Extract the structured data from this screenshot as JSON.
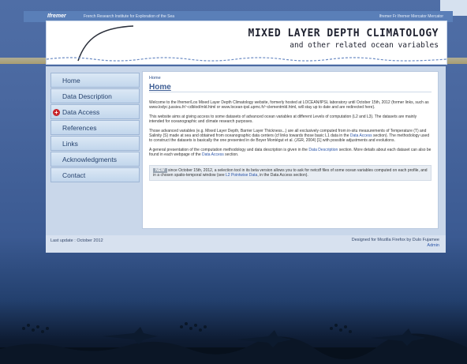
{
  "topbar": {
    "logo": "Ifremer",
    "tagline": "French Research Institute for Exploration of the Sea",
    "right_text": "Ifremer Fr Ifremer Mercator Mercator"
  },
  "banner": {
    "title": "MIXED LAYER DEPTH CLIMATOLOGY",
    "subtitle": "and other related ocean variables"
  },
  "sidebar": {
    "items": [
      {
        "label": "Home"
      },
      {
        "label": "Data Description"
      },
      {
        "label": "Data Access",
        "has_plus": true
      },
      {
        "label": "References"
      },
      {
        "label": "Links"
      },
      {
        "label": "Acknowledgments"
      },
      {
        "label": "Contact"
      }
    ]
  },
  "main": {
    "breadcrumb": "Home",
    "heading": "Home",
    "p1": "Welcome to the Ifremer/Los Mixed Layer Depth Climatology website, formerly hosted at LOCEAN/IPSL laboratory until October 15th, 2012 (former links, such as www.lodyc.jussieu.fr/~cdblod/mld.html or www.locean-ipsl.upmc.fr/~clementmld.html, will stay up to date and are redirected here).",
    "p2": "This website aims at giving access to some datasets of advanced ocean variables at different Levels of computation (L2 and L3). The datasets are mainly intended for oceanographic and climate research purposes.",
    "p3_pre": "Those advanced variables (e.g. Mixed Layer Depth, Barrier Layer Thickness...) are all exclusively computed from in-situ measurements of Temperature (T) and Salinity (S) made at sea and obtained from oceanographic data centers (cf links towards those basic L1 data in the ",
    "p3_link": "Data Access",
    "p3_post": " section). The methodology used to construct the datasets is basically the one presented in de Boyer Montégut et al. (JGR, 2004) [1] with possible adjustments and evolutions.",
    "p4_pre": "A general presentation of the computation methodology and data description is given in the ",
    "p4_link1": "Data Description",
    "p4_mid": " section. More details about each dataset can also be found in each webpage of the ",
    "p4_link2": "Data Access",
    "p4_post": " section.",
    "new_badge": "NEW",
    "new_pre": " since October 15th, 2012, a selection tool in its beta version allows you to ask for netcdf files of some ocean variables computed on each profile, and in a chosen spatio-temporal window (see ",
    "new_link": "L2 Pointwise Data",
    "new_post": ", in the Data Access section)."
  },
  "footer": {
    "last_update": "Last update : October 2012",
    "designed": "Designed for Mozilla Firefox by Dulo Fujamee",
    "admin": "Admin"
  }
}
